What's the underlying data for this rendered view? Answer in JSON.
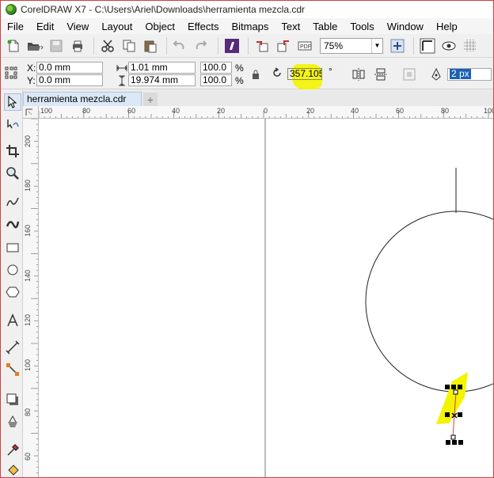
{
  "window": {
    "title": "CorelDRAW X7 - C:\\Users\\Ariel\\Downloads\\herramienta mezcla.cdr"
  },
  "menu": {
    "items": [
      "File",
      "Edit",
      "View",
      "Layout",
      "Object",
      "Effects",
      "Bitmaps",
      "Text",
      "Table",
      "Tools",
      "Window",
      "Help"
    ]
  },
  "toolbar": {
    "zoom_value": "75%"
  },
  "propbar": {
    "x_label": "X:",
    "x_value": "0.0 mm",
    "y_label": "Y:",
    "y_value": "0.0 mm",
    "width_value": "1.01 mm",
    "height_value": "19.974 mm",
    "scale_w": "100.0",
    "scale_h": "100.0",
    "percent": "%",
    "rotation_value": "357.105",
    "degree": "°",
    "outline_width": "2 px"
  },
  "tabs": {
    "document": "herramienta mezcla.cdr",
    "add": "+"
  },
  "ruler_h": [
    "100",
    "80",
    "60",
    "40",
    "20",
    "0",
    "20",
    "40",
    "60",
    "80",
    "100"
  ],
  "ruler_v": [
    "200",
    "180",
    "160",
    "140",
    "120",
    "100",
    "80",
    "60"
  ],
  "colors": {
    "highlight": "#f4f400",
    "selection_handle": "#000000",
    "window_border": "#d04040"
  }
}
